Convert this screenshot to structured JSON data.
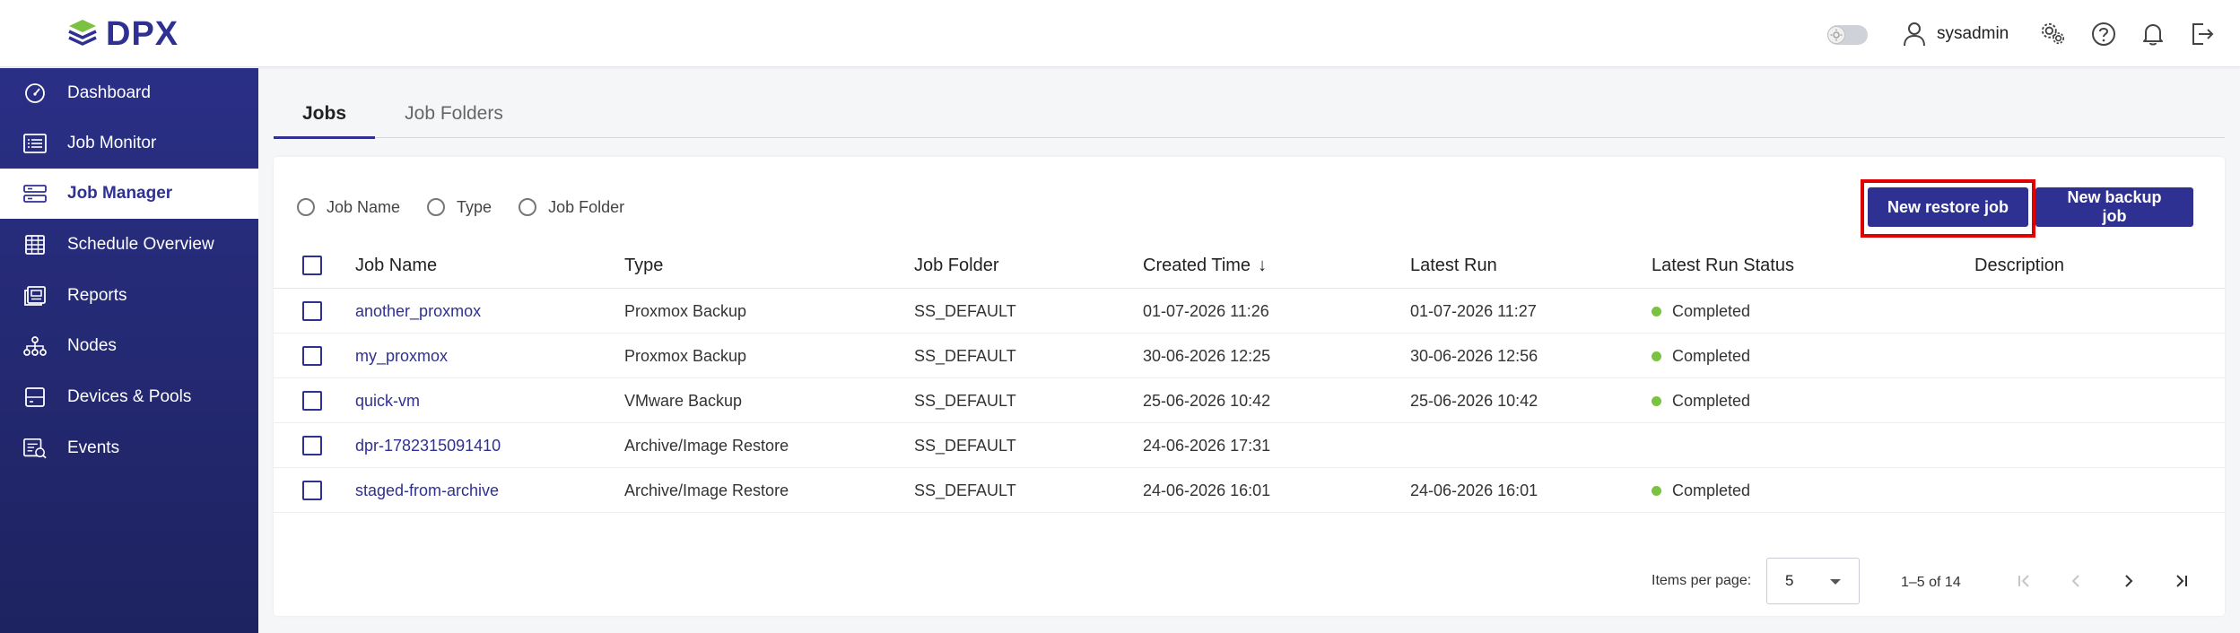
{
  "header": {
    "logo_text": "DPX",
    "username": "sysadmin",
    "icons": [
      "theme-toggle",
      "user-icon",
      "settings-icon",
      "help-icon",
      "bell-icon",
      "logout-icon"
    ]
  },
  "sidebar": {
    "items": [
      {
        "label": "Dashboard",
        "icon": "dashboard-icon",
        "active": false
      },
      {
        "label": "Job Monitor",
        "icon": "monitor-list-icon",
        "active": false
      },
      {
        "label": "Job Manager",
        "icon": "job-manager-icon",
        "active": true
      },
      {
        "label": "Schedule Overview",
        "icon": "calendar-icon",
        "active": false
      },
      {
        "label": "Reports",
        "icon": "reports-icon",
        "active": false
      },
      {
        "label": "Nodes",
        "icon": "nodes-icon",
        "active": false
      },
      {
        "label": "Devices & Pools",
        "icon": "devices-icon",
        "active": false
      },
      {
        "label": "Events",
        "icon": "events-icon",
        "active": false
      }
    ]
  },
  "tabs": [
    {
      "label": "Jobs",
      "active": true
    },
    {
      "label": "Job Folders",
      "active": false
    }
  ],
  "filters": {
    "options": [
      "Job Name",
      "Type",
      "Job Folder"
    ]
  },
  "actions": {
    "restore_label": "New restore job",
    "backup_label": "New backup job"
  },
  "table": {
    "columns": [
      "Job Name",
      "Type",
      "Job Folder",
      "Created Time",
      "Latest Run",
      "Latest Run Status",
      "Description"
    ],
    "sort_indicator": "↓",
    "rows": [
      {
        "name": "another_proxmox",
        "type": "Proxmox Backup",
        "folder": "SS_DEFAULT",
        "created": "01-07-2026 11:26",
        "latest_run": "01-07-2026 11:27",
        "status": "Completed",
        "description": ""
      },
      {
        "name": "my_proxmox",
        "type": "Proxmox Backup",
        "folder": "SS_DEFAULT",
        "created": "30-06-2026 12:25",
        "latest_run": "30-06-2026 12:56",
        "status": "Completed",
        "description": ""
      },
      {
        "name": "quick-vm",
        "type": "VMware Backup",
        "folder": "SS_DEFAULT",
        "created": "25-06-2026 10:42",
        "latest_run": "25-06-2026 10:42",
        "status": "Completed",
        "description": ""
      },
      {
        "name": "dpr-1782315091410",
        "type": "Archive/Image Restore",
        "folder": "SS_DEFAULT",
        "created": "24-06-2026 17:31",
        "latest_run": "",
        "status": "",
        "description": ""
      },
      {
        "name": "staged-from-archive",
        "type": "Archive/Image Restore",
        "folder": "SS_DEFAULT",
        "created": "24-06-2026 16:01",
        "latest_run": "24-06-2026 16:01",
        "status": "Completed",
        "description": ""
      }
    ],
    "status_color": "#7cc242"
  },
  "pagination": {
    "items_per_page_label": "Items per page:",
    "items_per_page": "5",
    "range": "1–5 of 14"
  },
  "colors": {
    "brand": "#2e3192",
    "highlight": "#e00000"
  }
}
